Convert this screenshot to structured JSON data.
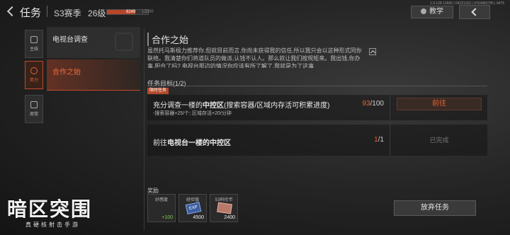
{
  "header": {
    "title": "任务",
    "season_label": "S3赛季",
    "level_label": "26级",
    "xp_current": "8249",
    "xp_max": "12000",
    "xp_progress": 0.69,
    "version_text": "1.0.128.13660 | 04221152 | 9754983785 | 9475",
    "teach_label": "教学"
  },
  "tabs": [
    {
      "label": "主线",
      "icon": "mainline-icon"
    },
    {
      "label": "势力",
      "icon": "faction-icon",
      "active": true
    },
    {
      "label": "周常",
      "icon": "weekly-icon"
    }
  ],
  "quest_list": [
    {
      "label": "电视台调查"
    },
    {
      "label": "合作之始",
      "active": true
    }
  ],
  "detail": {
    "title": "合作之始",
    "description": "虽然托马斯极力推荐你,但就目前而言,你尚未获得我的信任,所以我只会以这种形式同你联络。我清楚你们将道队员的做派,认钱不认人。那么就让我们按规矩来。我出钱,你办事,胆合了吗? 电视台那边的情况你应该有所了解了,我就是为了这事"
  },
  "objectives": {
    "header": "任务目标(1/2)",
    "tag": "限时任务",
    "items": [
      {
        "main_prefix": "充分调查一楼的",
        "main_highlight": "中控区",
        "main_suffix": "(搜索容器/区域内存活可积累进度)",
        "sub": "-搜索容器+25/个; 区域存活+20/分钟",
        "current": "93",
        "total": "/100",
        "action_label": "前往"
      },
      {
        "main_prefix": "前往",
        "main_highlight": "电视台一楼的中控区",
        "main_suffix": "",
        "current": "1",
        "total": "/1",
        "status_label": "已完成"
      }
    ]
  },
  "rewards": {
    "header": "奖励",
    "items": [
      {
        "name": "好感度",
        "value": "+100",
        "icon": "favor-icon"
      },
      {
        "name": "经验值",
        "value": "4500",
        "icon": "exp-icon"
      },
      {
        "name": "S3科伦币",
        "value": "2400",
        "icon": "cash-icon"
      }
    ]
  },
  "abandon_label": "放弃任务",
  "logo": {
    "main": "暗区突围",
    "sub": "真硬核射击手游"
  },
  "colors": {
    "accent": "#e8632f",
    "active_tab": "#c24a2a"
  }
}
